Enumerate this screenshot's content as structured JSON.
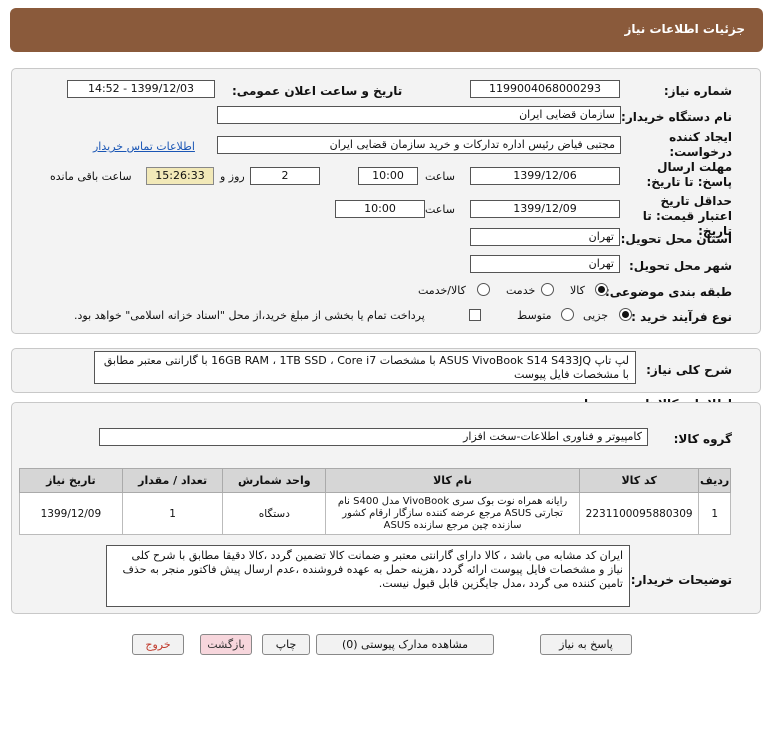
{
  "header": {
    "title": "جزئیات اطلاعات نیاز"
  },
  "form": {
    "need_number_label": "شماره نیاز:",
    "need_number": "1199004068000293",
    "announce_label": "تاریخ و ساعت اعلان عمومی:",
    "announce_value": "1399/12/03 - 14:52",
    "buyer_label": "نام دستگاه خریدار:",
    "buyer_value": "سازمان قضایی ایران",
    "creator_label": "ایجاد کننده درخواست:",
    "creator_value": "مجتبی  فیاض رئیس اداره تدارکات و خرید سازمان قضایی ایران",
    "contact_link": "اطلاعات تماس خریدار",
    "deadline_label": "مهلت ارسال پاسخ: تا تاریخ:",
    "deadline_date": "1399/12/06",
    "time_label": "ساعت",
    "deadline_time": "10:00",
    "days_value": "2",
    "days_label": "روز و",
    "remaining_time": "15:26:33",
    "remaining_label": "ساعت باقی مانده",
    "validity_label": "حداقل تاریخ اعتبار قیمت: تا تاریخ:",
    "validity_date": "1399/12/09",
    "validity_time": "10:00",
    "province_label": "استان محل تحویل:",
    "province_value": "تهران",
    "city_label": "شهر محل تحویل:",
    "city_value": "تهران",
    "category_label": "طبقه بندی موضوعی:",
    "category_options": [
      "کالا",
      "خدمت",
      "کالا/خدمت"
    ],
    "category_selected": "کالا",
    "process_label": "نوع فرآیند خرید :",
    "process_options": [
      "جزیی",
      "متوسط"
    ],
    "process_selected": "جزیی",
    "payment_note": "پرداخت تمام یا بخشی از مبلغ خرید،از محل \"اسناد خزانه اسلامی\" خواهد بود."
  },
  "summary": {
    "label": "شرح کلی نیاز:",
    "text": "لپ تاپ  ASUS VivoBook S14 S433JQ  با مشخصات 16GB RAM ، 1TB SSD ،  Core i7 با گارانتی معتبر مطابق با مشخصات فایل پیوست"
  },
  "goods": {
    "section_title": "اطلاعات کالاهای مورد نیاز",
    "group_label": "گروه کالا:",
    "group_value": "کامپیوتر و فناوری اطلاعات-سخت افزار",
    "columns": [
      "ردیف",
      "کد کالا",
      "نام کالا",
      "واحد شمارش",
      "تعداد / مقدار",
      "تاریخ نیاز"
    ],
    "rows": [
      {
        "row": "1",
        "code": "2231100095880309",
        "name": "رایانه همراه نوت بوک سری VivoBook مدل S400 نام تجارتی ASUS مرجع عرضه کننده سازگار ارقام کشور سازنده چین مرجع سازنده ASUS",
        "unit": "دستگاه",
        "qty": "1",
        "date": "1399/12/09"
      }
    ]
  },
  "buyer_notes": {
    "label": "توضیحات خریدار:",
    "text": "ایران کد مشابه می باشد ، کالا دارای گارانتی معتبر و ضمانت  کالا تضمین گردد ،کالا دقیقا مطابق با شرح کلی نیاز و مشخصات فایل پیوست ارائه گردد ،هزینه حمل به عهده فروشنده ،عدم ارسال پیش فاکتور منجر به حذف تامین کننده می گردد ،مدل جایگزین قابل قبول نیست."
  },
  "actions": {
    "reply": "پاسخ به نیاز",
    "attachments": "مشاهده مدارک پیوستی (0)",
    "print": "چاپ",
    "back": "بازگشت",
    "exit": "خروج"
  },
  "colors": {
    "header": "#8a5a3b",
    "timer_bg": "#f2e9b8",
    "link": "#1a56b5"
  }
}
